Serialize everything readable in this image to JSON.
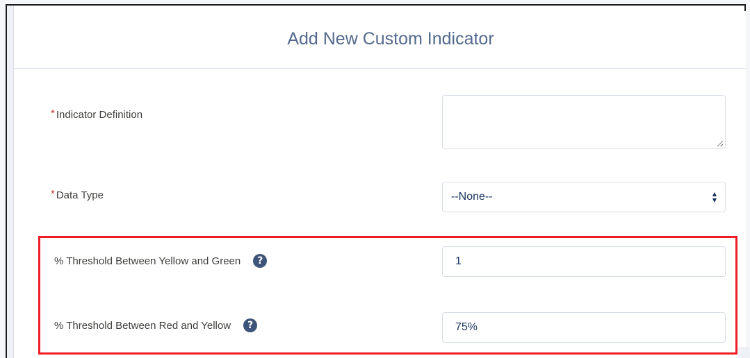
{
  "modal": {
    "title": "Add New Custom Indicator"
  },
  "form": {
    "required_marker": "*",
    "indicator_definition": {
      "label": "Indicator Definition",
      "value": ""
    },
    "data_type": {
      "label": "Data Type",
      "selected": "--None--"
    },
    "threshold_yellow_green": {
      "label": "% Threshold Between Yellow and Green",
      "value": "1"
    },
    "threshold_red_yellow": {
      "label": "% Threshold Between Red and Yellow",
      "value": "75%"
    },
    "help_icon_glyph": "?"
  },
  "colors": {
    "highlight": "#ee1c25",
    "help_icon": "#3e5478",
    "required": "#c23934",
    "title": "#54698d"
  },
  "icons": {
    "help": "question-circle-icon",
    "select": "up-down-arrows-icon",
    "resize": "resize-grip-icon"
  }
}
